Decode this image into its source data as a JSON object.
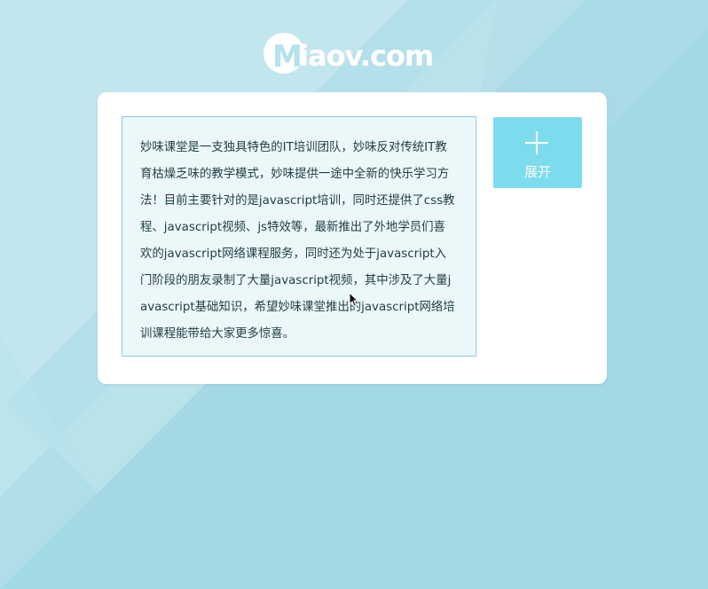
{
  "logo": {
    "mark": "M",
    "text": "iaov.com"
  },
  "article": {
    "text": "妙味课堂是一支独具特色的IT培训团队，妙味反对传统IT教育枯燥乏味的教学模式，妙味提供一途中全新的快乐学习方法！目前主要针对的是javascript培训，同时还提供了css教程、javascript视频、js特效等，最新推出了外地学员们喜欢的javascript网络课程服务，同时还为处于javascript入门阶段的朋友录制了大量javascript视频，其中涉及了大量javascript基础知识，希望妙味课堂推出的javascript网络培训课程能带给大家更多惊喜。"
  },
  "expand_button": {
    "icon": "plus-icon",
    "label": "展开"
  },
  "colors": {
    "background": "#a3d8e4",
    "accent": "#7ddbee",
    "text_box_bg": "#ebf7f9",
    "text_box_border": "#87d0de"
  }
}
